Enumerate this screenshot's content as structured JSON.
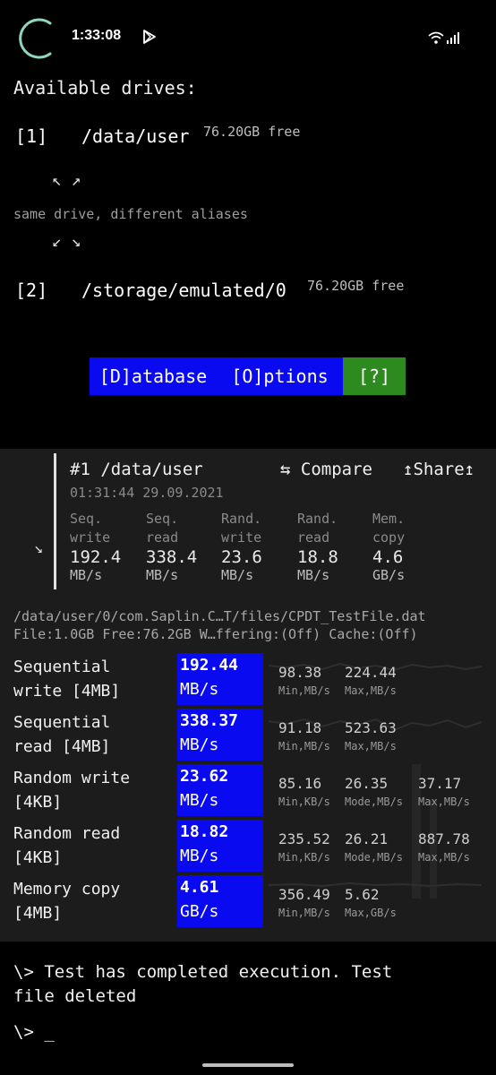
{
  "status": {
    "time": "1:33:08"
  },
  "main": {
    "heading": "Available drives:",
    "drives": [
      {
        "tag": "[1]",
        "path": "/data/user",
        "free": "76.20GB free"
      },
      {
        "tag": "[2]",
        "path": "/storage/emulated/0",
        "free": "76.20GB free"
      }
    ],
    "alias_note": "same drive, different aliases",
    "arrows_top": "↖ ↗",
    "arrows_bottom": "↙ ↘"
  },
  "menu": {
    "database": "[D]atabase",
    "options": "[O]ptions",
    "help": "[?]"
  },
  "result": {
    "title": "#1 /data/user",
    "timestamp": "01:31:44 29.09.2021",
    "compare_label": "⇆ Compare",
    "share_label": "↥Share↥",
    "expand_glyph": "↘",
    "summary": [
      {
        "l1": "Seq.",
        "l2": "write",
        "value": "192.4",
        "unit": "MB/s"
      },
      {
        "l1": "Seq.",
        "l2": "read",
        "value": "338.4",
        "unit": "MB/s"
      },
      {
        "l1": "Rand.",
        "l2": "write",
        "value": "23.6",
        "unit": "MB/s"
      },
      {
        "l1": "Rand.",
        "l2": "read",
        "value": "18.8",
        "unit": "MB/s"
      },
      {
        "l1": "Mem.",
        "l2": "copy",
        "value": "4.6",
        "unit": "GB/s"
      }
    ],
    "file_path": "/data/user/0/com.Saplin.C…T/files/CPDT_TestFile.dat",
    "file_info": "File:1.0GB Free:76.2GB W…ffering:(Off) Cache:(Off)",
    "tests": [
      {
        "l1": "Sequential",
        "l2": "write [4MB]",
        "value": "192.44",
        "unit": "MB/s",
        "stats": [
          {
            "num": "98.38",
            "unit": "Min,MB/s"
          },
          {
            "num": "224.44",
            "unit": "Max,MB/s"
          }
        ]
      },
      {
        "l1": "Sequential",
        "l2": "read [4MB]",
        "value": "338.37",
        "unit": "MB/s",
        "stats": [
          {
            "num": "91.18",
            "unit": "Min,MB/s"
          },
          {
            "num": "523.63",
            "unit": "Max,MB/s"
          }
        ]
      },
      {
        "l1": "Random write",
        "l2": "[4KB]",
        "value": "23.62",
        "unit": "MB/s",
        "stats": [
          {
            "num": "85.16",
            "unit": "Min,KB/s"
          },
          {
            "num": "26.35",
            "unit": "Mode,MB/s"
          },
          {
            "num": "37.17",
            "unit": "Max,MB/s"
          }
        ]
      },
      {
        "l1": "Random read",
        "l2": "[4KB]",
        "value": "18.82",
        "unit": "MB/s",
        "stats": [
          {
            "num": "235.52",
            "unit": "Min,KB/s"
          },
          {
            "num": "26.21",
            "unit": "Mode,MB/s"
          },
          {
            "num": "887.78",
            "unit": "Max,MB/s"
          }
        ]
      },
      {
        "l1": "Memory copy",
        "l2": "[4MB]",
        "value": "4.61",
        "unit": "GB/s",
        "stats": [
          {
            "num": "356.49",
            "unit": "Min,MB/s"
          },
          {
            "num": "5.62",
            "unit": "Max,GB/s"
          }
        ]
      }
    ]
  },
  "terminal": {
    "line1": "\\> Test has completed execution. Test",
    "line2": "file deleted",
    "prompt": "\\> _"
  },
  "colors": {
    "accent_blue": "#0a0af0",
    "accent_green": "#2d8a1e",
    "spinner": "#8fd6bf"
  }
}
